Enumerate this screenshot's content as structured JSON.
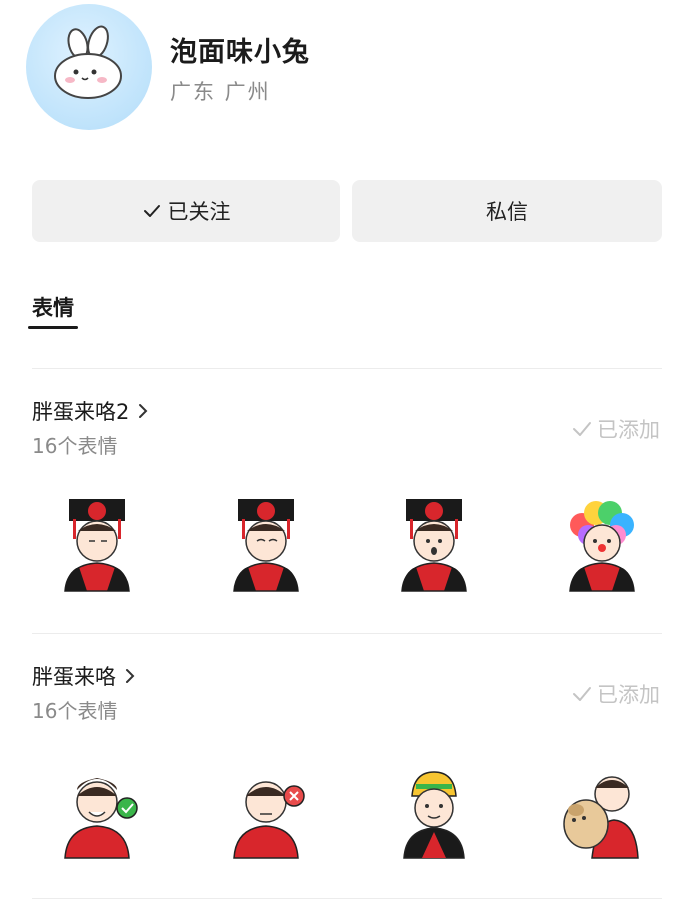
{
  "profile": {
    "name": "泡面味小兔",
    "location": "广东 广州"
  },
  "actions": {
    "follow_label": "已关注",
    "message_label": "私信"
  },
  "tabs": {
    "active_label": "表情"
  },
  "packs": [
    {
      "title": "胖蛋来咯2",
      "count": "16个表情",
      "status": "已添加"
    },
    {
      "title": "胖蛋来咯",
      "count": "16个表情",
      "status": "已添加"
    }
  ],
  "colors": {
    "avatar_bg": "#bfe3fb",
    "button_bg": "#f0f0f0",
    "muted_text": "#8a8a8a",
    "added_text": "#c4c4c4",
    "shirt_red": "#d8262c"
  },
  "icons": [
    "rabbit-icon",
    "check-icon",
    "chevron-right-icon"
  ]
}
